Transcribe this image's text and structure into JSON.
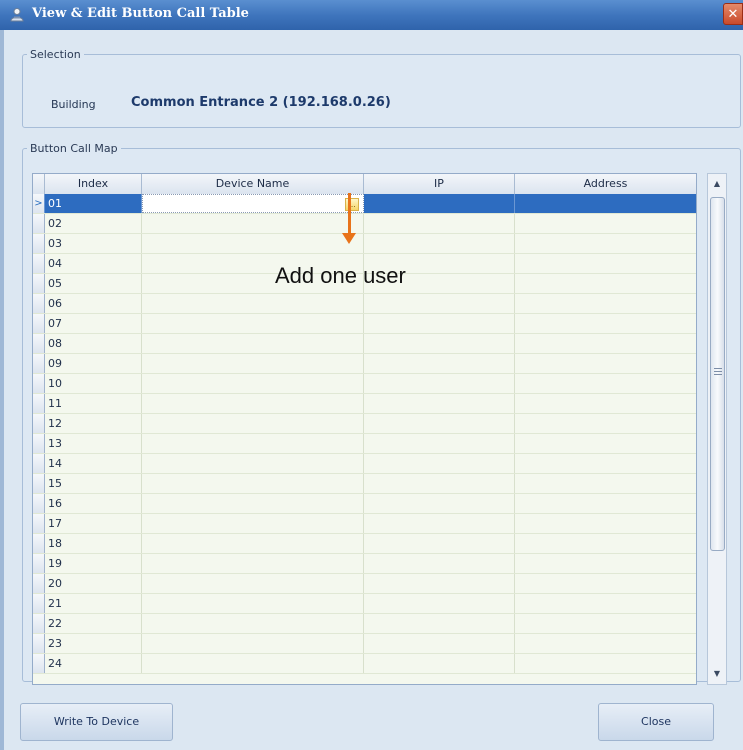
{
  "window": {
    "title": "View & Edit Button Call Table",
    "close_glyph": "✕",
    "icon": "group-users-icon"
  },
  "selection": {
    "legend": "Selection",
    "building_label": "Building",
    "building_value": "Common Entrance 2 (192.168.0.26)"
  },
  "callmap": {
    "legend": "Button Call Map",
    "columns": [
      "Index",
      "Device Name",
      "IP",
      "Address"
    ],
    "rows": [
      "01",
      "02",
      "03",
      "04",
      "05",
      "06",
      "07",
      "08",
      "09",
      "10",
      "11",
      "12",
      "13",
      "14",
      "15",
      "16",
      "17",
      "18",
      "19",
      "20",
      "21",
      "22",
      "23",
      "24"
    ],
    "selected_index": "01",
    "current_row_marker": ">",
    "ellipsis": "..."
  },
  "buttons": {
    "write_to_device": "Write To Device",
    "close": "Close"
  },
  "scrollbar": {
    "up": "▲",
    "down": "▼"
  },
  "annotation": {
    "text": "Add one user",
    "color": "#e8731a"
  },
  "colors": {
    "title_bar": "#3f75bd",
    "selected_row": "#2d6cc0",
    "grid_background": "#f4f8ee"
  }
}
